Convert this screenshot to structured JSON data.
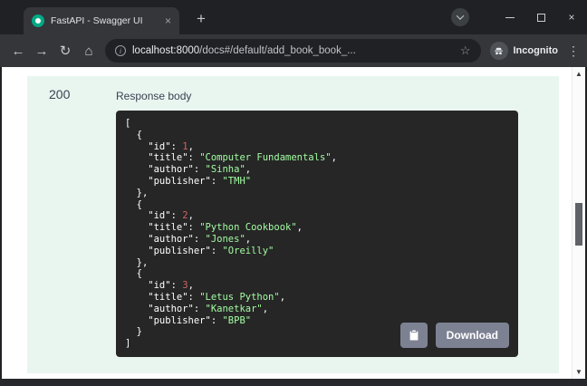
{
  "colors": {
    "panel_bg": "#e9f6f0",
    "code_bg": "#262626",
    "code_string": "#a2fca2",
    "code_number": "#d36363",
    "code_punct": "#ffffff",
    "button_bg": "#7d8293",
    "status_text": "#3b4151",
    "accent_green": "#49cc90"
  },
  "glyphs": {
    "tab_close": "×",
    "new_tab": "+",
    "back": "←",
    "forward": "→",
    "reload": "↻",
    "home": "⌂",
    "info": "i",
    "star": "☆",
    "menu": "⋮",
    "window_close": "×",
    "scroll_up": "▲",
    "scroll_down": "▼"
  },
  "window": {
    "tab": {
      "title": "FastAPI - Swagger UI"
    }
  },
  "toolbar": {
    "url": {
      "host": "localhost:8000",
      "path": "/docs#/default/add_book_book_..."
    },
    "incognito_label": "Incognito"
  },
  "content": {
    "status_code": "200",
    "response_body_label": "Response body",
    "download_button": "Download",
    "books": [
      {
        "id": 1,
        "title": "Computer Fundamentals",
        "author": "Sinha",
        "publisher": "TMH"
      },
      {
        "id": 2,
        "title": "Python Cookbook",
        "author": "Jones",
        "publisher": "Oreilly"
      },
      {
        "id": 3,
        "title": "Letus Python",
        "author": "Kanetkar",
        "publisher": "BPB"
      }
    ]
  }
}
